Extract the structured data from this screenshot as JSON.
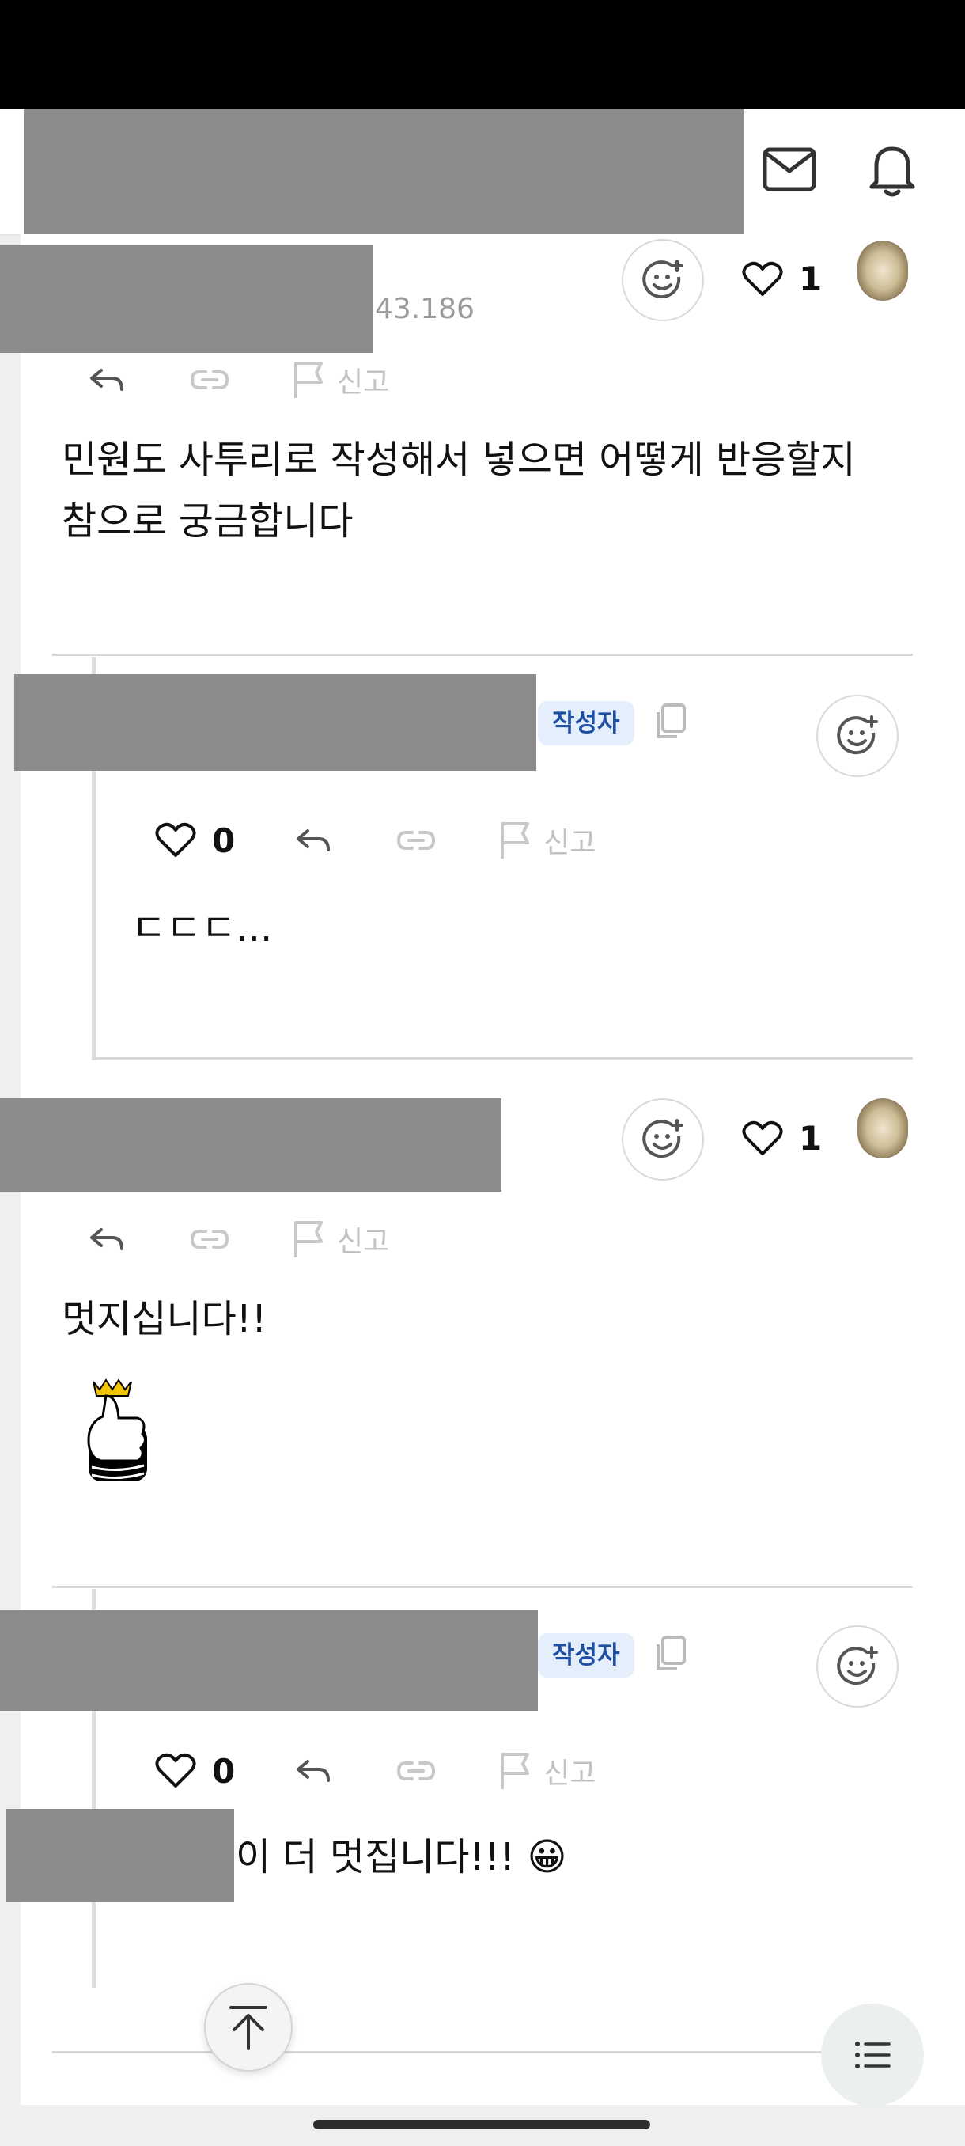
{
  "header": {
    "icons": [
      "mail-icon",
      "bell-icon"
    ]
  },
  "comments": [
    {
      "ip_suffix": "43.186",
      "likes": "1",
      "report_label": "신고",
      "text_line1": "민원도 사투리로 작성해서 넣으면 어떻게 반응할지",
      "text_line2": "참으로 궁금합니다"
    },
    {
      "author_badge": "작성자",
      "likes": "0",
      "report_label": "신고",
      "text": "ㄷㄷㄷ..."
    },
    {
      "likes": "1",
      "report_label": "신고",
      "text": "멋지십니다!!"
    },
    {
      "author_badge": "작성자",
      "likes": "0",
      "report_label": "신고",
      "text": "이 더 멋집니다!!! 😀"
    }
  ],
  "colors": {
    "badge_bg": "#e5eefb",
    "badge_text": "#1f4fa3",
    "redaction": "#8c8c8c"
  }
}
